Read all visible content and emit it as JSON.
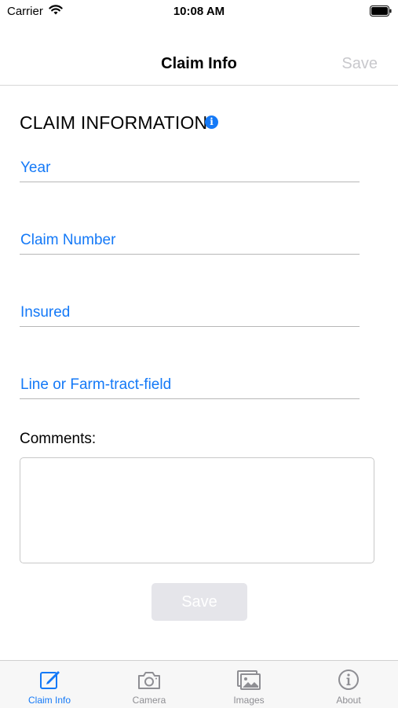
{
  "status_bar": {
    "carrier": "Carrier",
    "time": "10:08 AM"
  },
  "nav": {
    "title": "Claim Info",
    "save_label": "Save"
  },
  "section": {
    "title": "CLAIM INFORMATION",
    "info_icon": "info-icon"
  },
  "fields": [
    {
      "label": "Year"
    },
    {
      "label": "Claim Number"
    },
    {
      "label": "Insured"
    },
    {
      "label": "Line or Farm-tract-field"
    }
  ],
  "comments": {
    "label": "Comments:",
    "value": ""
  },
  "save_button": {
    "label": "Save",
    "enabled": false
  },
  "tabs": [
    {
      "label": "Claim Info",
      "icon": "edit-icon",
      "active": true
    },
    {
      "label": "Camera",
      "icon": "camera-icon",
      "active": false
    },
    {
      "label": "Images",
      "icon": "images-icon",
      "active": false
    },
    {
      "label": "About",
      "icon": "info-circle-icon",
      "active": false
    }
  ],
  "colors": {
    "accent": "#1479f7",
    "disabled": "#c8c8cc",
    "tab_inactive": "#8e8e93"
  }
}
